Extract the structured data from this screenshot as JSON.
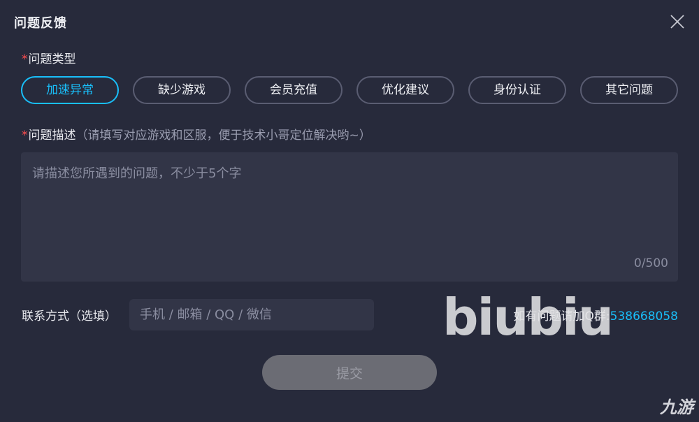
{
  "dialog": {
    "title": "问题反馈",
    "close_icon": "close-icon"
  },
  "issue_type": {
    "required_mark": "*",
    "label": "问题类型",
    "options": [
      {
        "label": "加速异常",
        "selected": true
      },
      {
        "label": "缺少游戏",
        "selected": false
      },
      {
        "label": "会员充值",
        "selected": false
      },
      {
        "label": "优化建议",
        "selected": false
      },
      {
        "label": "身份认证",
        "selected": false
      },
      {
        "label": "其它问题",
        "selected": false
      }
    ]
  },
  "description": {
    "required_mark": "*",
    "label": "问题描述",
    "hint": "（请填写对应游戏和区服，便于技术小哥定位解决哟~）",
    "value": "",
    "placeholder": "请描述您所遇到的问题，不少于5个字",
    "counter": "0/500"
  },
  "contact": {
    "label": "联系方式（选填）",
    "value": "",
    "placeholder": "手机 / 邮箱 / QQ / 微信"
  },
  "support": {
    "label": "如有问题请加Q群:",
    "qq_group": "538668058"
  },
  "submit": {
    "label": "提交"
  },
  "watermarks": {
    "center": "biubiu",
    "corner": "九游"
  },
  "colors": {
    "background": "#272a3b",
    "input_background": "#323547",
    "accent": "#19bffa",
    "required": "#ff4d4f",
    "submit_disabled": "#6b6c74"
  }
}
